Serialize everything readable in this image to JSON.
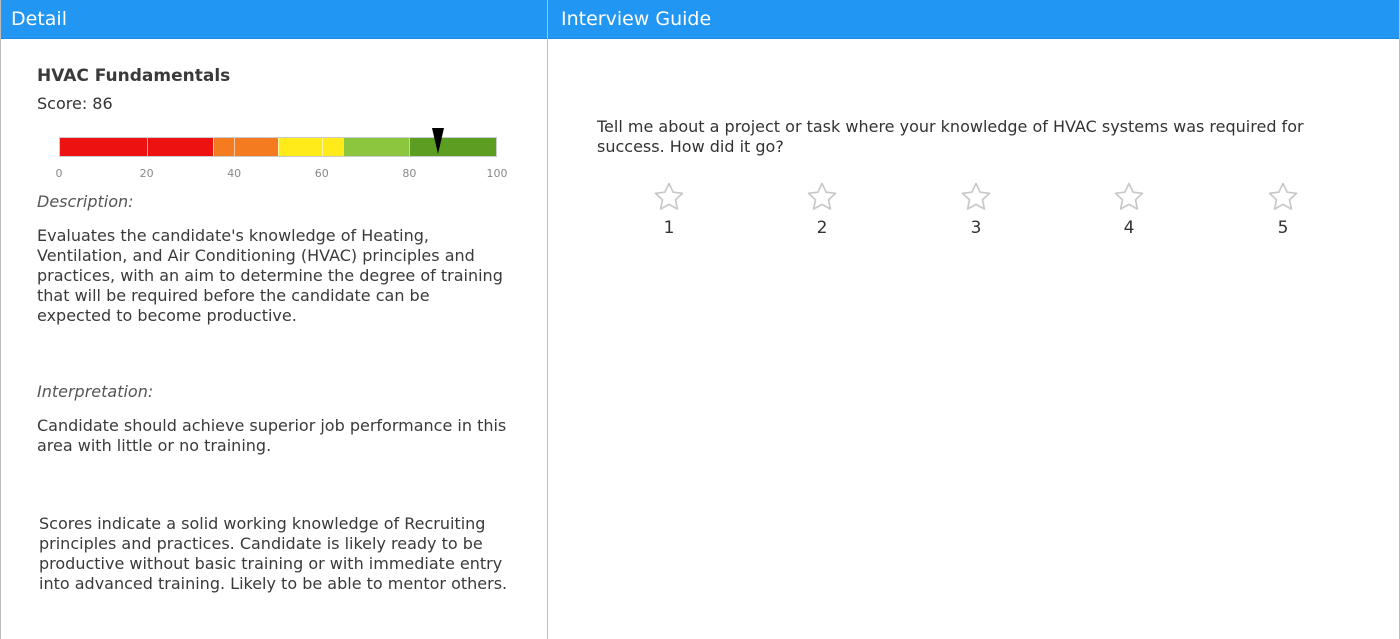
{
  "panels": {
    "detail": {
      "title": "Detail"
    },
    "interview": {
      "title": "Interview Guide"
    }
  },
  "skill": {
    "name": "HVAC Fundamentals",
    "score_label": "Score:",
    "score_value": "86",
    "score": 86,
    "description_label": "Description:",
    "description": "Evaluates the candidate's knowledge of Heating, Ventilation, and Air Conditioning (HVAC) principles and practices, with an aim to determine the degree of training that will be required before the candidate can be expected to become productive.",
    "interpretation_label": "Interpretation:",
    "interpretation": "Candidate should achieve superior job performance in this area with little or no training.",
    "summary": "Scores indicate a solid working knowledge of Recruiting principles and practices. Candidate is likely ready to be productive without basic training or with immediate entry into advanced training. Likely to be able to mentor others."
  },
  "gauge": {
    "ticks": [
      "0",
      "20",
      "40",
      "60",
      "80",
      "100"
    ],
    "colors": {
      "red": "#ee1111",
      "orange": "#f47b20",
      "yellow": "#ffeb1a",
      "light_green": "#8cc63f",
      "dark_green": "#5c9e21"
    }
  },
  "interview": {
    "question": "Tell me about a project or task where your knowledge of HVAC systems was required for success. How did it go?",
    "ratings": [
      "1",
      "2",
      "3",
      "4",
      "5"
    ]
  }
}
